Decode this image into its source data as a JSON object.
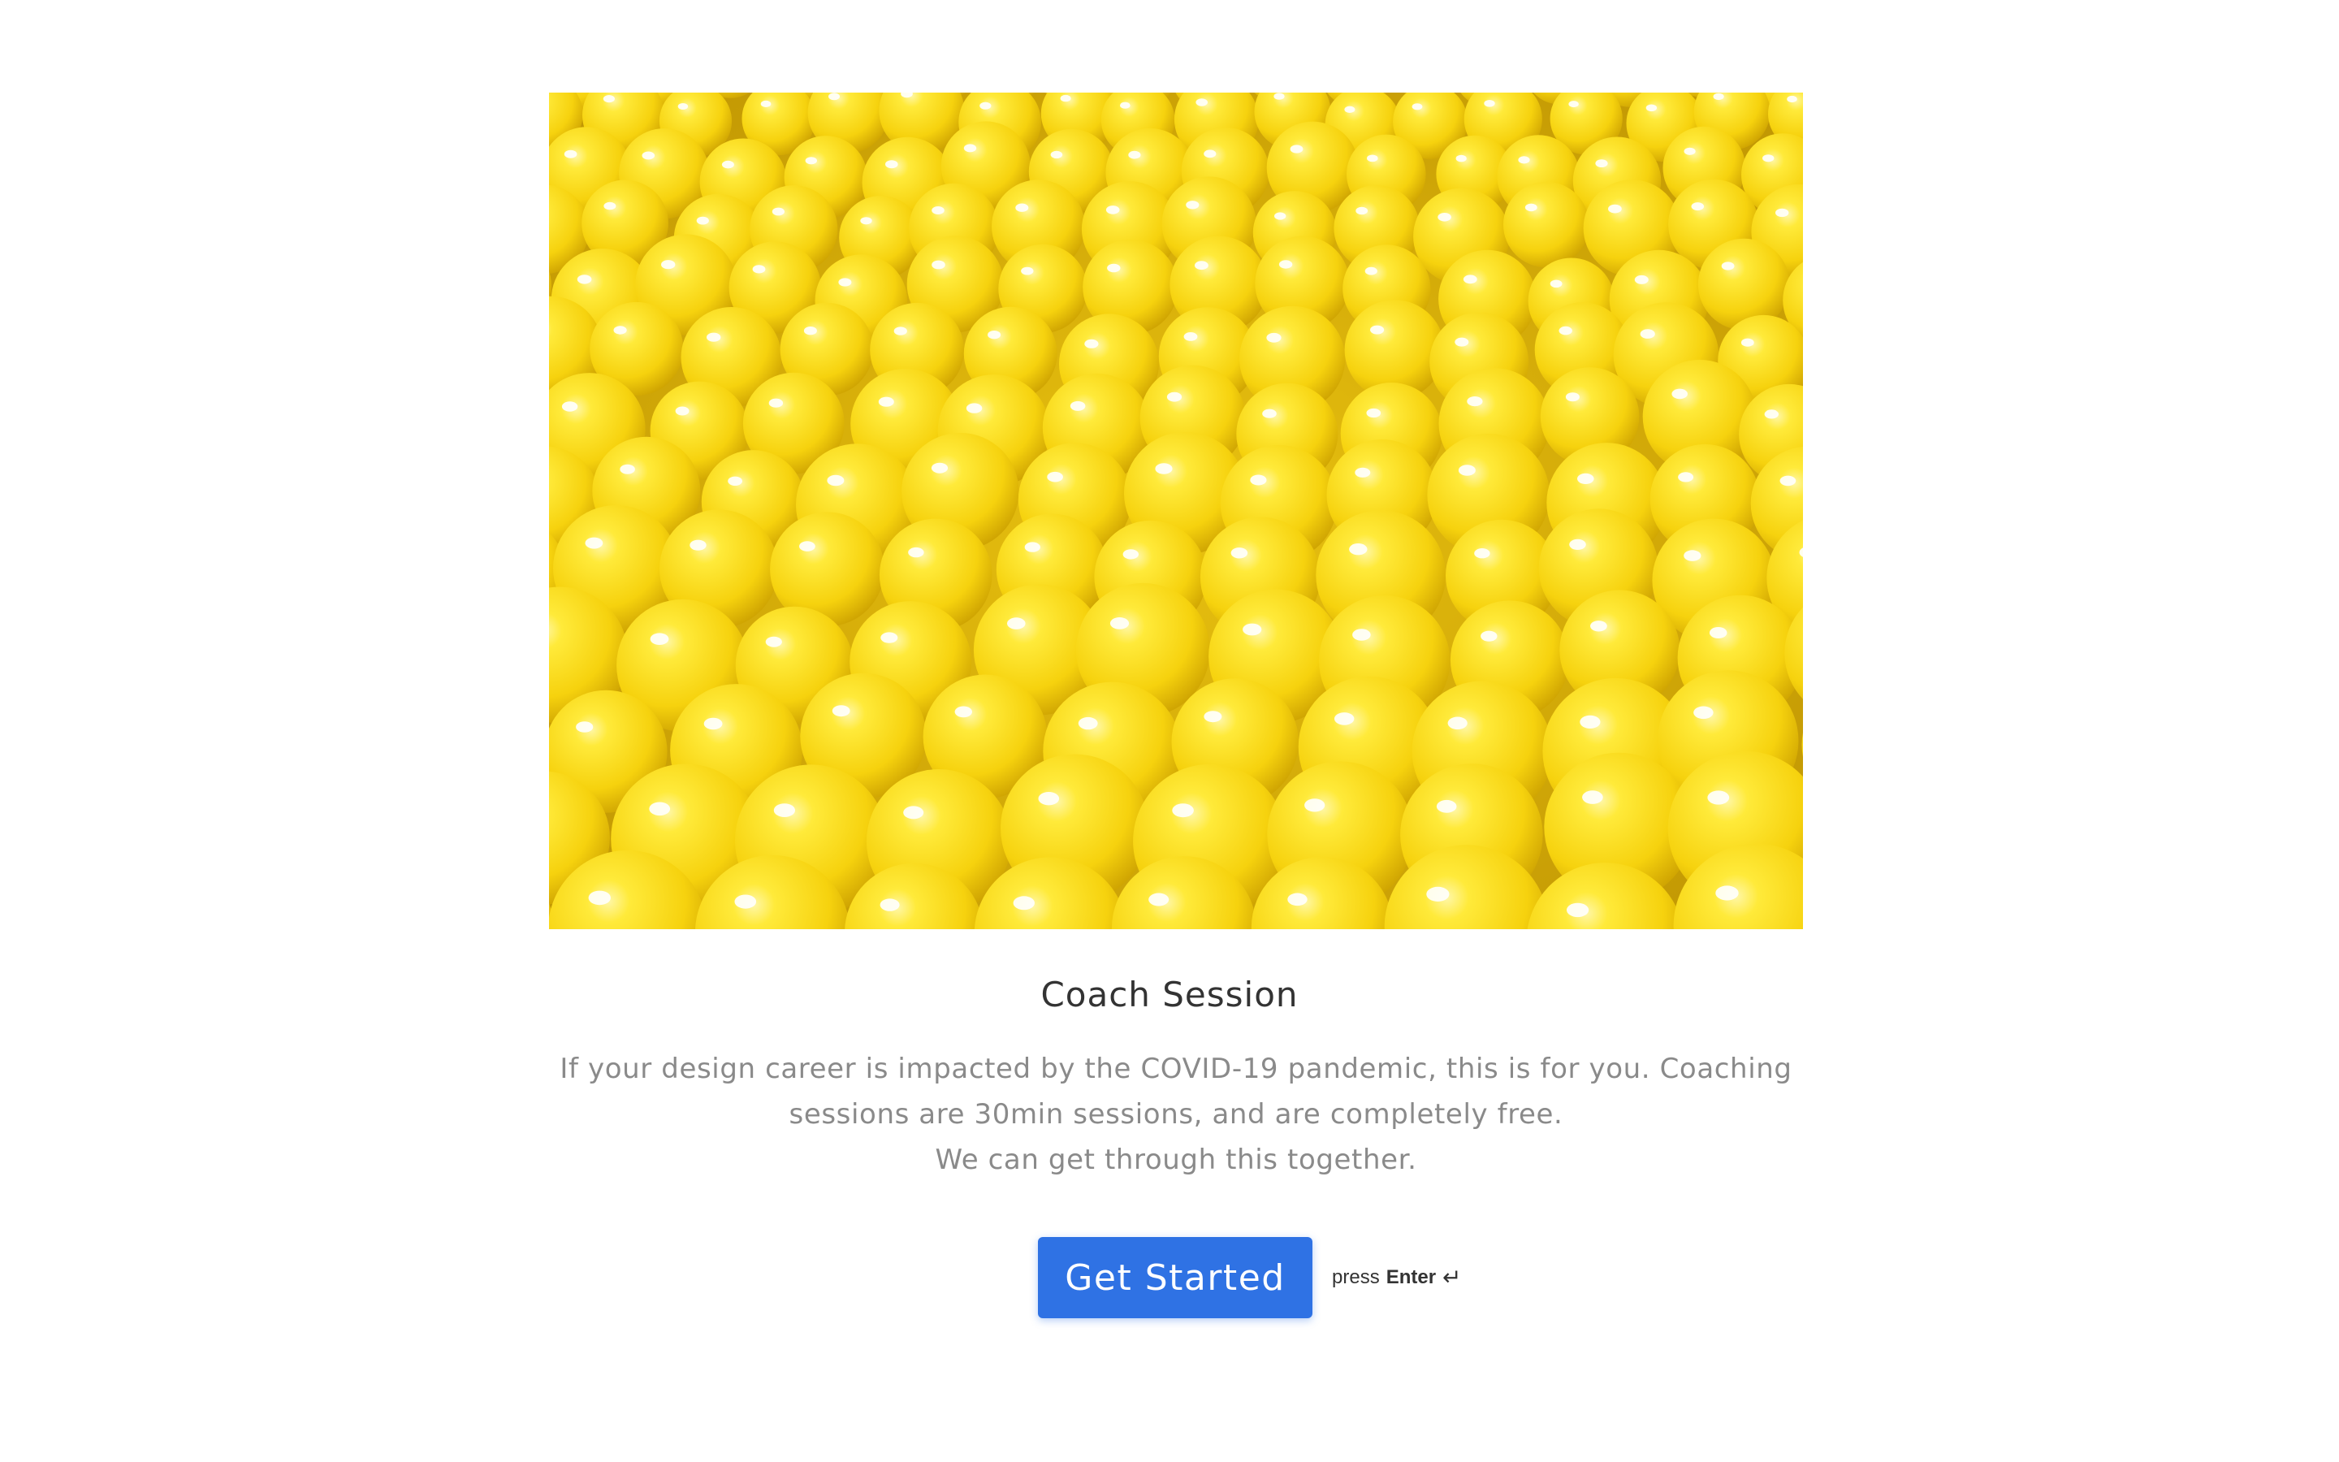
{
  "cover": {
    "alt": "Yellow plastic balls",
    "base_color": "#f2cf17"
  },
  "title": "Coach Session",
  "description": {
    "line1": "If your design career is impacted by the COVID-19 pandemic, this is for you. Coaching",
    "line2": "sessions are 30min sessions, and are completely free.",
    "line3": "We can get through this together."
  },
  "cta": {
    "label": "Get Started",
    "color": "#2f72e4",
    "hint_prefix": "press",
    "hint_key": "Enter",
    "hint_icon": "↵"
  }
}
